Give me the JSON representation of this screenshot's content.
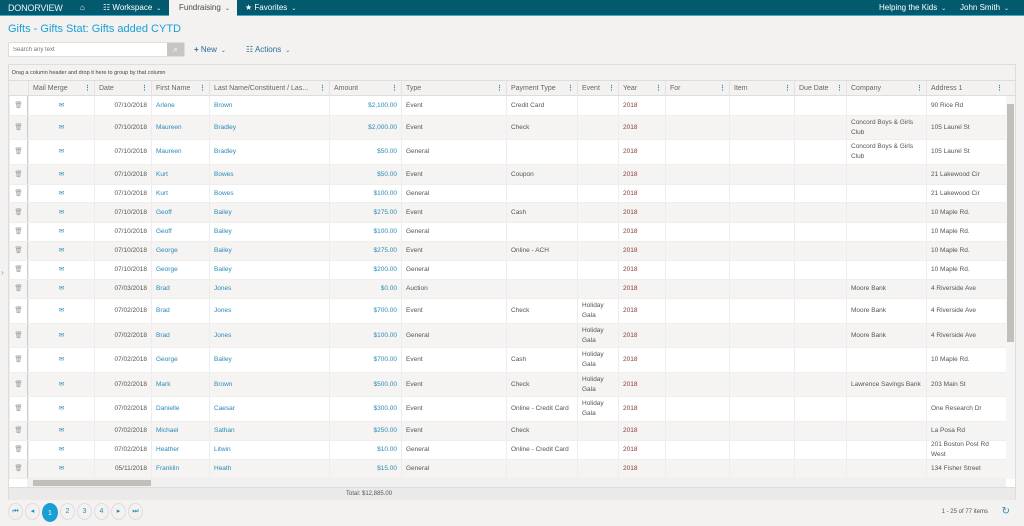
{
  "topbar": {
    "logo": "DONORVIEW",
    "home_icon": "home-icon",
    "workspace": "Workspace",
    "fundraising": "Fundraising",
    "favorites": "Favorites",
    "org": "Helping the Kids",
    "user": "John Smith"
  },
  "page_title": "Gifts - Gifts Stat: Gifts added CYTD",
  "toolbar": {
    "search_placeholder": "Search any text",
    "new_label": "New",
    "actions_label": "Actions"
  },
  "grid": {
    "group_hint": "Drag a column header and drop it here to group by that column",
    "columns": [
      "Mail Merge",
      "Date",
      "First Name",
      "Last Name/Constituent / Las...",
      "Amount",
      "Type",
      "Payment Type",
      "Event",
      "Year",
      "For",
      "Item",
      "Due Date",
      "Company",
      "Address 1"
    ],
    "rows": [
      [
        "07/10/2018",
        "Arlene",
        "Brown",
        "$2,100.00",
        "Event",
        "Credit Card",
        "",
        "2018",
        "",
        "",
        "",
        "",
        "90 Rice Rd"
      ],
      [
        "07/10/2018",
        "Maureen",
        "Bradley",
        "$2,000.00",
        "Event",
        "Check",
        "",
        "2018",
        "",
        "",
        "",
        "Concord Boys & Girls Club",
        "105 Laurel St"
      ],
      [
        "07/10/2018",
        "Maureen",
        "Bradley",
        "$50.00",
        "General",
        "",
        "",
        "2018",
        "",
        "",
        "",
        "Concord Boys & Girls Club",
        "105 Laurel St"
      ],
      [
        "07/10/2018",
        "Kurt",
        "Bowes",
        "$50.00",
        "Event",
        "Coupon",
        "",
        "2018",
        "",
        "",
        "",
        "",
        "21 Lakewood Cir"
      ],
      [
        "07/10/2018",
        "Kurt",
        "Bowes",
        "$100.00",
        "General",
        "",
        "",
        "2018",
        "",
        "",
        "",
        "",
        "21 Lakewood Cir"
      ],
      [
        "07/10/2018",
        "Geoff",
        "Bailey",
        "$275.00",
        "Event",
        "Cash",
        "",
        "2018",
        "",
        "",
        "",
        "",
        "10 Maple Rd."
      ],
      [
        "07/10/2018",
        "Geoff",
        "Bailey",
        "$100.00",
        "General",
        "",
        "",
        "2018",
        "",
        "",
        "",
        "",
        "10 Maple Rd."
      ],
      [
        "07/10/2018",
        "George",
        "Bailey",
        "$275.00",
        "Event",
        "Online - ACH",
        "",
        "2018",
        "",
        "",
        "",
        "",
        "10 Maple Rd."
      ],
      [
        "07/10/2018",
        "George",
        "Bailey",
        "$200.00",
        "General",
        "",
        "",
        "2018",
        "",
        "",
        "",
        "",
        "10 Maple Rd."
      ],
      [
        "07/03/2018",
        "Brad",
        "Jones",
        "$0.00",
        "Auction",
        "",
        "",
        "2018",
        "",
        "",
        "",
        "Moore Bank",
        "4 Riverside Ave"
      ],
      [
        "07/02/2018",
        "Brad",
        "Jones",
        "$700.00",
        "Event",
        "Check",
        "Holiday Gala",
        "2018",
        "",
        "",
        "",
        "Moore Bank",
        "4 Riverside Ave"
      ],
      [
        "07/02/2018",
        "Brad",
        "Jones",
        "$100.00",
        "General",
        "",
        "Holiday Gala",
        "2018",
        "",
        "",
        "",
        "Moore Bank",
        "4 Riverside Ave"
      ],
      [
        "07/02/2018",
        "George",
        "Bailey",
        "$700.00",
        "Event",
        "Cash",
        "Holiday Gala",
        "2018",
        "",
        "",
        "",
        "",
        "10 Maple Rd."
      ],
      [
        "07/02/2018",
        "Mark",
        "Brown",
        "$500.00",
        "Event",
        "Check",
        "Holiday Gala",
        "2018",
        "",
        "",
        "",
        "Lawrence Savings Bank",
        "203 Main St"
      ],
      [
        "07/02/2018",
        "Danielle",
        "Caesar",
        "$300.00",
        "Event",
        "Online - Credit Card",
        "Holiday Gala",
        "2018",
        "",
        "",
        "",
        "",
        "One Research Dr"
      ],
      [
        "07/02/2018",
        "Michael",
        "Sathan",
        "$250.00",
        "Event",
        "Check",
        "",
        "2018",
        "",
        "",
        "",
        "",
        "La Posa Rd"
      ],
      [
        "07/02/2018",
        "Heather",
        "Litwin",
        "$10.00",
        "General",
        "Online - Credit Card",
        "",
        "2018",
        "",
        "",
        "",
        "",
        "201 Boston Post Rd West"
      ],
      [
        "05/11/2018",
        "Franklin",
        "Heath",
        "$15.00",
        "General",
        "",
        "",
        "2018",
        "",
        "",
        "",
        "",
        "134 Fisher Street"
      ]
    ],
    "total": "Total: $12,885.00"
  },
  "pager": {
    "pages": [
      "1",
      "2",
      "3",
      "4"
    ],
    "current": "1",
    "info": "1 - 25 of 77 items"
  }
}
